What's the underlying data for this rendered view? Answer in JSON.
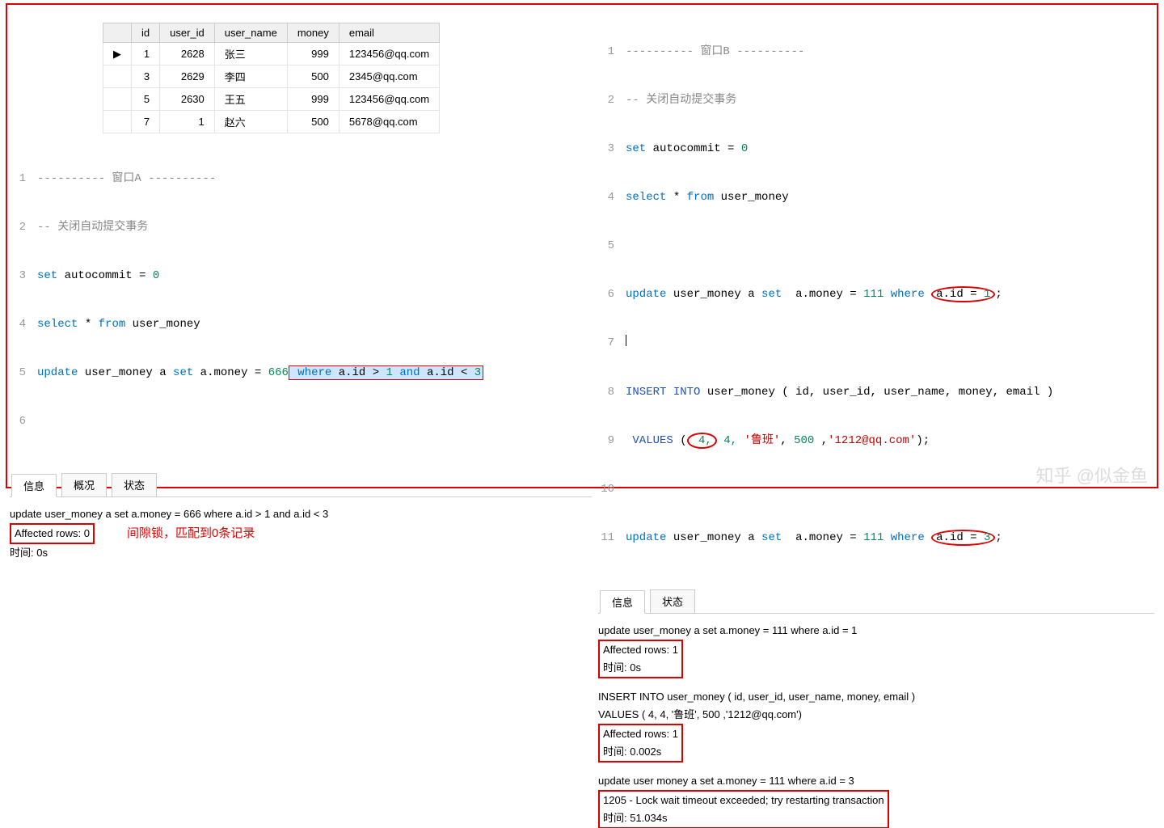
{
  "chart_data": {
    "type": "table",
    "columns": [
      "id",
      "user_id",
      "user_name",
      "money",
      "email"
    ],
    "rows": [
      {
        "id": 1,
        "user_id": 2628,
        "user_name": "张三",
        "money": 999,
        "email": "123456@qq.com"
      },
      {
        "id": 3,
        "user_id": 2629,
        "user_name": "李四",
        "money": 500,
        "email": "2345@qq.com"
      },
      {
        "id": 5,
        "user_id": 2630,
        "user_name": "王五",
        "money": 999,
        "email": "123456@qq.com"
      },
      {
        "id": 7,
        "user_id": 1,
        "user_name": "赵六",
        "money": 500,
        "email": "5678@qq.com"
      }
    ]
  },
  "table": {
    "h": {
      "id": "id",
      "user_id": "user_id",
      "user_name": "user_name",
      "money": "money",
      "email": "email"
    },
    "marker": "▶",
    "r0": {
      "id": "1",
      "uid": "2628",
      "nm": "张三",
      "mn": "999",
      "em": "123456@qq.com"
    },
    "r1": {
      "id": "3",
      "uid": "2629",
      "nm": "李四",
      "mn": "500",
      "em": "2345@qq.com"
    },
    "r2": {
      "id": "5",
      "uid": "2630",
      "nm": "王五",
      "mn": "999",
      "em": "123456@qq.com"
    },
    "r3": {
      "id": "7",
      "uid": "1",
      "nm": "赵六",
      "mn": "500",
      "em": "5678@qq.com"
    }
  },
  "left": {
    "l1": {
      "a": "----------",
      "b": " 窗口A ",
      "c": "----------"
    },
    "l2": "-- 关闭自动提交事务",
    "l3": {
      "a": "set",
      "b": " autocommit = ",
      "c": "0"
    },
    "l4": {
      "a": "select",
      "b": " * ",
      "c": "from",
      "d": " user_money"
    },
    "l5": {
      "a": "update",
      "b": " user_money a ",
      "c": "set",
      "d": " a.money = ",
      "e": "666",
      "f": " where",
      "g": " a.id > ",
      "h": "1",
      "i": " and",
      "j": " a.id < ",
      "k": "3"
    },
    "tabs": {
      "info": "信息",
      "ov": "概况",
      "st": "状态"
    },
    "m1": "update user_money a set a.money = 666 where a.id > 1 and a.id < 3",
    "m2": "Affected rows: 0",
    "m3": "时间: 0s",
    "note": "间隙锁，匹配到0条记录"
  },
  "right": {
    "l1": {
      "a": "----------",
      "b": " 窗口B ",
      "c": "----------"
    },
    "l2": "-- 关闭自动提交事务",
    "l3": {
      "a": "set",
      "b": " autocommit = ",
      "c": "0"
    },
    "l4": {
      "a": "select",
      "b": " * ",
      "c": "from",
      "d": " user_money"
    },
    "l6": {
      "a": "update",
      "b": " user_money a ",
      "c": "set",
      "d": "  a.money = ",
      "e": "111",
      "f": " where ",
      "g": "a.id = ",
      "h": "1",
      "i": ";"
    },
    "l8": {
      "a": "INSERT",
      "b": " INTO ",
      "c": "user_money ( id, user_id, user_name, money, email )"
    },
    "l9": {
      "a": " VALUES",
      "b": " (",
      "c": " 4,",
      "d": " 4, ",
      "e": "'鲁班'",
      "f": ", ",
      "g": "500",
      "h": " ,",
      "i": "'1212@qq.com'",
      "j": ");"
    },
    "l11": {
      "a": "update",
      "b": " user_money a ",
      "c": "set",
      "d": "  a.money = ",
      "e": "111",
      "f": " where ",
      "g": "a.id = ",
      "h": "3",
      "i": ";"
    },
    "tabs": {
      "info": "信息",
      "st": "状态"
    },
    "m1": "update user_money a set  a.money = 111 where a.id = 1",
    "m2": "Affected rows: 1",
    "m3": "时间: 0s",
    "m4": "INSERT INTO user_money ( id, user_id, user_name, money, email )",
    "m5": " VALUES ( 4, 4, '鲁班', 500 ,'1212@qq.com')",
    "m6": "Affected rows: 1",
    "m7": "时间: 0.002s",
    "m8": "update user money a set  a.money = 111 where a.id = 3",
    "m9": "1205 - Lock wait timeout exceeded; try restarting transaction",
    "m10": "时间: 51.034s"
  },
  "wm": "知乎 @似金鱼"
}
